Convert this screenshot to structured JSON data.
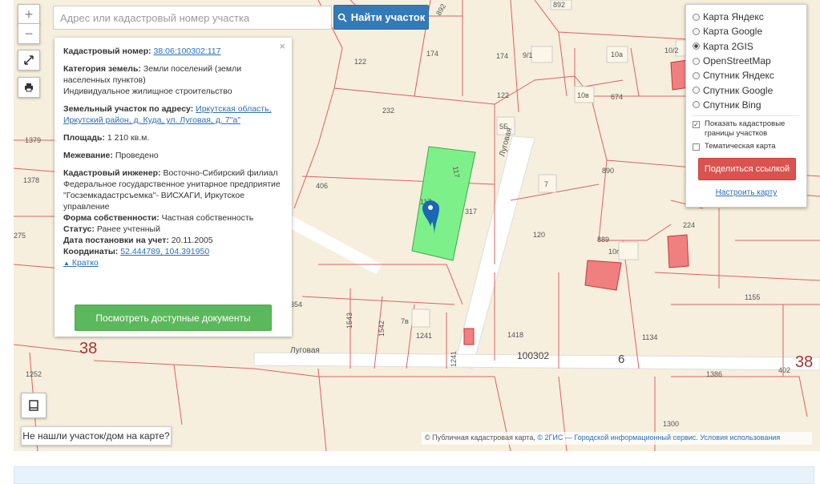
{
  "search": {
    "placeholder": "Адрес или кадастровый номер участка",
    "button_label": "Найти участок"
  },
  "zoom": {
    "in_label": "+",
    "out_label": "−"
  },
  "info": {
    "cadnum_label": "Кадастровый номер:",
    "cadnum_value": "38:06:100302:117",
    "category_label": "Категория земель:",
    "category_value": "Земли поселений (земли населенных пунктов)",
    "use_value": "Индивидуальное жилищное строительство",
    "address_label": "Земельный участок по адресу:",
    "address_value": "Иркутская область, Иркутский район, д. Куда, ул. Луговая, д. 7\"а\"",
    "area_label": "Площадь:",
    "area_value": "1 210 кв.м.",
    "survey_label": "Межевание:",
    "survey_value": "Проведено",
    "engineer_label": "Кадастровый инженер:",
    "engineer_value": "Восточно-Сибирский филиал Федеральное государственное унитарное предприятие \"Госземкадастрсъемка\"- ВИСХАГИ, Иркутское управление",
    "ownership_label": "Форма собственности:",
    "ownership_value": "Частная собственность",
    "status_label": "Статус:",
    "status_value": "Ранее учтенный",
    "date_label": "Дата постановки на учет:",
    "date_value": "20.11.2005",
    "coords_label": "Координаты:",
    "coords_value": "52.444789, 104.391950",
    "brief_label": "Кратко",
    "docs_button": "Посмотреть доступные документы",
    "close_symbol": "×"
  },
  "layers": {
    "options": [
      {
        "label": "Карта Яндекс",
        "selected": false
      },
      {
        "label": "Карта Google",
        "selected": false
      },
      {
        "label": "Карта 2GIS",
        "selected": true
      },
      {
        "label": "OpenStreetMap",
        "selected": false
      },
      {
        "label": "Спутник Яндекс",
        "selected": false
      },
      {
        "label": "Спутник Google",
        "selected": false
      },
      {
        "label": "Спутник Bing",
        "selected": false
      }
    ],
    "show_borders_label": "Показать кадастровые границы участков",
    "show_borders_checked": true,
    "thematic_label": "Тематическая карта",
    "thematic_checked": false,
    "share_button": "Поделиться ссылкой",
    "setup_link": "Настроить карту"
  },
  "notfound_button": "Не нашли участок/дом на карте?",
  "attribution": {
    "prefix": "© Публичная кадастровая карта, ",
    "link1": "© 2ГИС — Городской информационный сервис",
    "sep": ". ",
    "link2": "Условия использования"
  },
  "map_labels": {
    "l892a": "892",
    "l892b": "892",
    "l174": "174",
    "l174b": "174",
    "l91": "9/1",
    "l10a": "10а",
    "l102": "10/2",
    "l122": "122",
    "l122b": "122",
    "l232": "232",
    "l5b": "5Б",
    "l10v": "10в",
    "l674": "674",
    "l1379": "1379",
    "l1378": "1378",
    "l275": "275",
    "l406": "406",
    "l117": "117",
    "l117b": "117",
    "l317": "317",
    "l7": "7",
    "l890": "890",
    "l120": "120",
    "l889": "889",
    "l10g": "10г",
    "l224": "224",
    "l354": "354",
    "l1543": "1543",
    "l1542": "1542",
    "l7v": "7в",
    "l1241": "1241",
    "l1241b": "1241",
    "l1418": "1418",
    "l1134": "1134",
    "l1155": "1155",
    "l1386": "1386",
    "l402": "402",
    "l1252": "1252",
    "l1300": "1300",
    "l100302": "100302",
    "l6": "6",
    "l38a": "38",
    "l38b": "38",
    "street_lugovaya": "Луговая",
    "street_lugovaya_v": "Луговая"
  },
  "colors": {
    "plot_fill": "#7ef08a",
    "building_fill": "#f08080",
    "parcel_line": "#e06060",
    "pin": "#1b67b6",
    "map_bg": "#f6efdd"
  },
  "icons": [
    "search-icon",
    "fullscreen-icon",
    "print-icon",
    "book-icon",
    "map-pin-icon",
    "caret-up-icon"
  ]
}
